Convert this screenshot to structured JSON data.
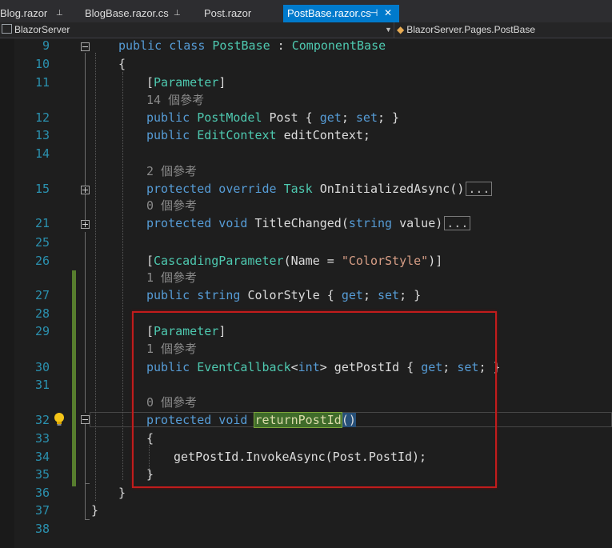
{
  "tabs": [
    {
      "label": "Blog.razor",
      "pinned": true
    },
    {
      "label": "BlogBase.razor.cs",
      "pinned": true
    },
    {
      "label": "Post.razor",
      "pinned": false
    },
    {
      "label": "PostBase.razor.cs",
      "pinned": true,
      "active": true,
      "close": "✕"
    }
  ],
  "nav": {
    "project": "BlazorServer",
    "scope": "BlazorServer.Pages.PostBase"
  },
  "line_numbers": [
    "9",
    "10",
    "11",
    "12",
    "13",
    "14",
    "15",
    "21",
    "25",
    "26",
    "27",
    "28",
    "29",
    "30",
    "31",
    "32",
    "33",
    "34",
    "35",
    "36",
    "37",
    "38"
  ],
  "code": {
    "l9_kw": "public class ",
    "l9_type": "PostBase",
    "l9_sep": " : ",
    "l9_base": "ComponentBase",
    "l10": "{",
    "l11_open": "[",
    "l11_attr": "Parameter",
    "l11_close": "]",
    "ref14": "14 個參考",
    "l12_kw": "public ",
    "l12_type": "PostModel",
    "l12_name": " Post { ",
    "l12_get": "get",
    "l12_semi": "; ",
    "l12_set": "set",
    "l12_end": "; }",
    "l13_kw": "public ",
    "l13_type": "EditContext",
    "l13_name": " editContext;",
    "ref2": "2 個參考",
    "l15_kw": "protected override ",
    "l15_type": "Task",
    "l15_name": " OnInitializedAsync()",
    "collapsed": "...",
    "ref0a": "0 個參考",
    "l21_kw": "protected void ",
    "l21_name": "TitleChanged(",
    "l21_pkw": "string",
    "l21_rest": " value)",
    "l26_open": "[",
    "l26_attr": "CascadingParameter",
    "l26_mid": "(Name = ",
    "l26_str": "\"ColorStyle\"",
    "l26_close": ")]",
    "ref1a": "1 個參考",
    "l27_kw": "public string ",
    "l27_name": "ColorStyle { ",
    "l27_get": "get",
    "l27_semi": "; ",
    "l27_set": "set",
    "l27_end": "; }",
    "l29_open": "[",
    "l29_attr": "Parameter",
    "l29_close": "]",
    "ref1b": "1 個參考",
    "l30_kw": "public ",
    "l30_type": "EventCallback",
    "l30_lt": "<",
    "l30_int": "int",
    "l30_gt": "> getPostId { ",
    "l30_get": "get",
    "l30_semi": "; ",
    "l30_set": "set",
    "l30_end": "; }",
    "ref0b": "0 個參考",
    "l32_kw": "protected void ",
    "l32_name": "returnPostId",
    "l32_paren": "()",
    "l33": "{",
    "l34": "getPostId.InvokeAsync(Post.PostId);",
    "l35": "}",
    "l36": "}",
    "l37": "}"
  },
  "colors": {
    "keyword": "#569cd6",
    "type": "#4ec9b0",
    "string": "#d69d85",
    "line_number": "#2b91af",
    "highlight_box": "#c21c1c",
    "change_bar": "#577d2e",
    "tab_active": "#007acc"
  },
  "icons": [
    "pin-icon",
    "close-icon",
    "dropdown-arrow-icon",
    "lightbulb-icon",
    "expand-icon",
    "collapse-icon"
  ]
}
